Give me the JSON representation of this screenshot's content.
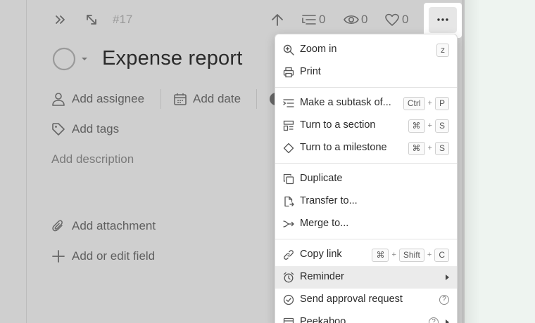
{
  "task": {
    "id": "#17",
    "title": "Expense report",
    "subtask_count": "0",
    "watcher_count": "0",
    "like_count": "0",
    "assignee_label": "Add assignee",
    "date_label": "Add date",
    "tags_label": "Add tags",
    "description_placeholder": "Add description",
    "attachment_label": "Add attachment",
    "field_label": "Add or edit field"
  },
  "menu": {
    "items": [
      {
        "label": "Zoom in",
        "icon": "zoom-in-icon",
        "keys": [
          "z"
        ]
      },
      {
        "label": "Print",
        "icon": "printer-icon",
        "keys": []
      },
      {
        "label": "Make a subtask of...",
        "icon": "subtask-icon",
        "keys": [
          "Ctrl",
          "P"
        ]
      },
      {
        "label": "Turn to a section",
        "icon": "section-icon",
        "keys": [
          "⌘",
          "S"
        ]
      },
      {
        "label": "Turn to a milestone",
        "icon": "milestone-icon",
        "keys": [
          "⌘",
          "S"
        ]
      },
      {
        "label": "Duplicate",
        "icon": "duplicate-icon",
        "keys": []
      },
      {
        "label": "Transfer to...",
        "icon": "transfer-icon",
        "keys": []
      },
      {
        "label": "Merge to...",
        "icon": "merge-icon",
        "keys": []
      },
      {
        "label": "Copy link",
        "icon": "link-icon",
        "keys": [
          "⌘",
          "Shift",
          "C"
        ]
      },
      {
        "label": "Reminder",
        "icon": "alarm-icon",
        "keys": [],
        "submenu": true,
        "highlighted": true
      },
      {
        "label": "Send approval request",
        "icon": "approval-icon",
        "keys": [],
        "help": "?"
      },
      {
        "label": "Peekaboo",
        "icon": "peekaboo-icon",
        "keys": [],
        "help": "?",
        "submenu": true
      }
    ]
  },
  "colors": {
    "panel_bg": "#cfcfcf",
    "menu_bg": "#ffffff",
    "highlight_bg": "#ebebeb"
  }
}
